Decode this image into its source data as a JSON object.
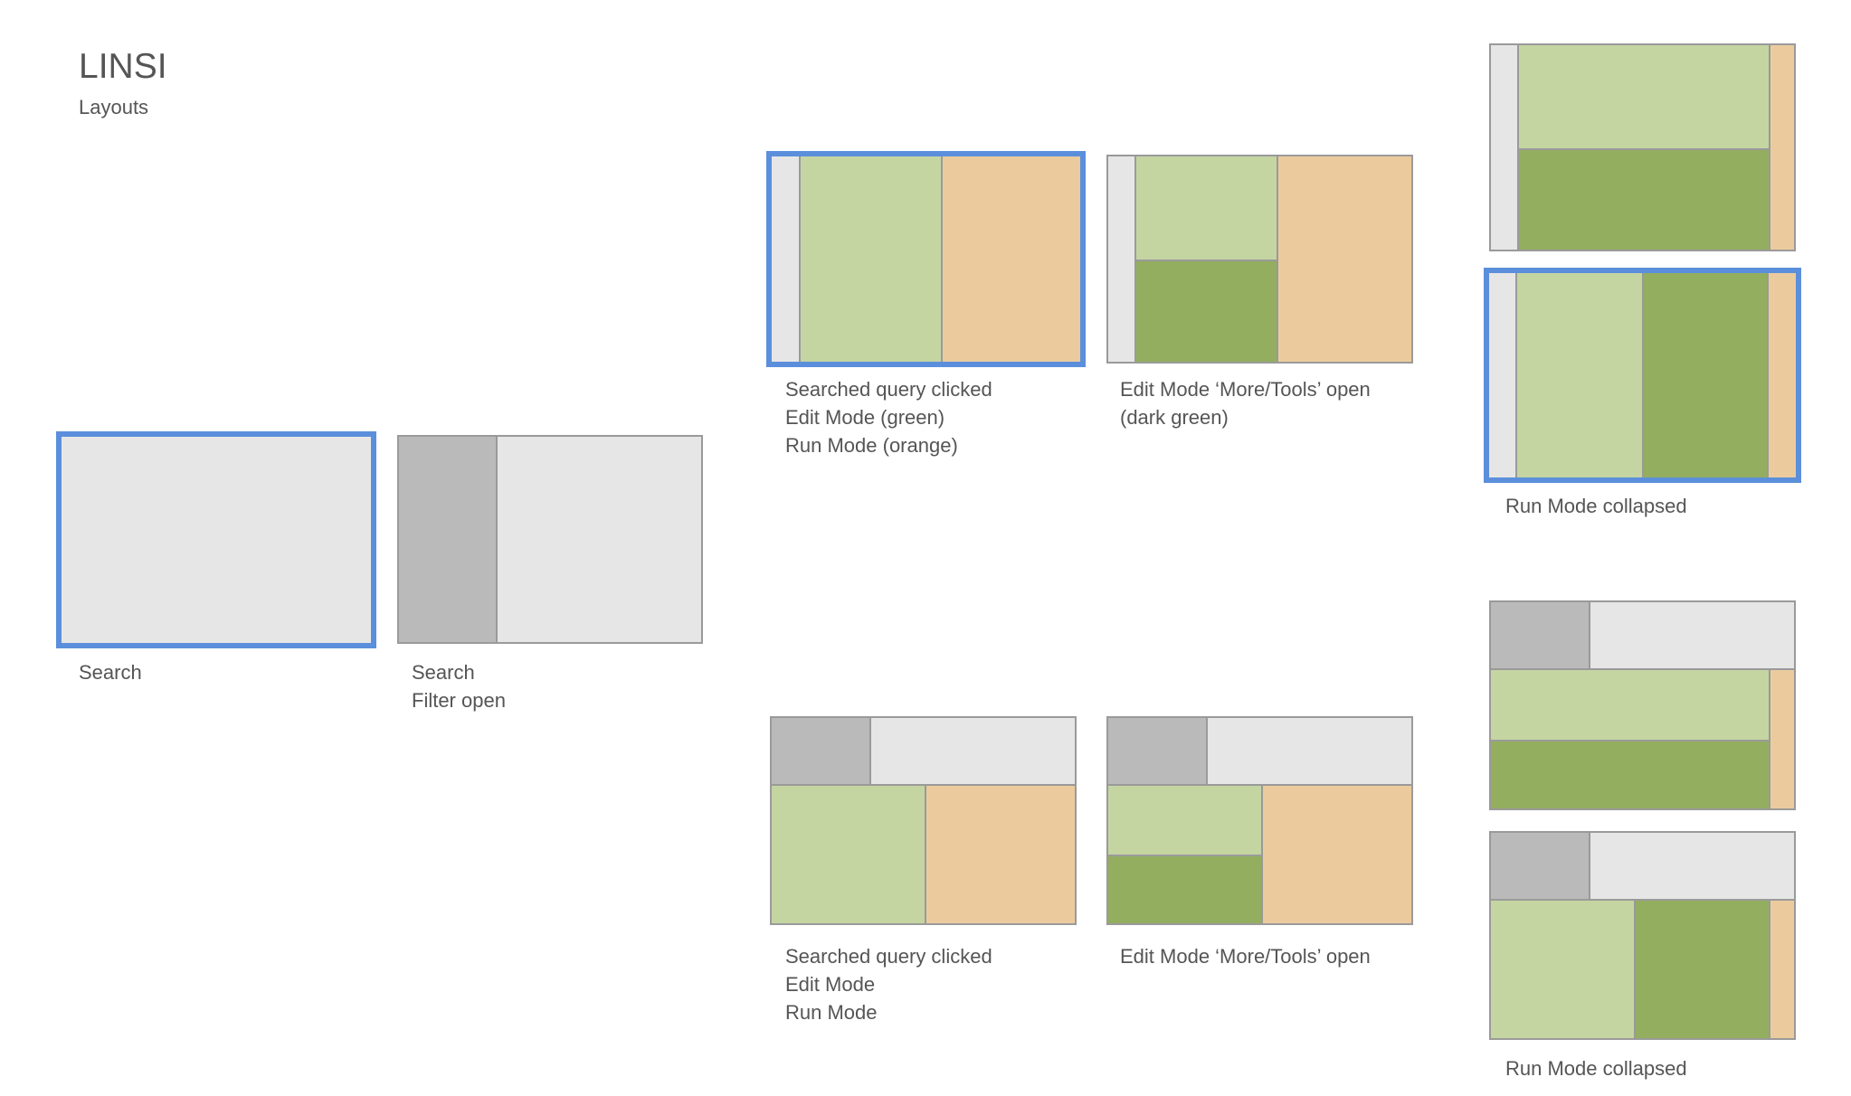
{
  "header": {
    "title": "LINSI",
    "subtitle": "Layouts"
  },
  "colors": {
    "selected_border": "#5b8fdb",
    "pane_light_grey": "#e6e6e6",
    "pane_mid_grey": "#bababa",
    "edit_mode_green": "#c4d5a2",
    "more_tools_dark_green": "#93ae5f",
    "run_mode_orange": "#ebcb9e"
  },
  "layouts": {
    "search": {
      "lines": [
        "Search"
      ]
    },
    "search_filter": {
      "lines": [
        "Search",
        "Filter open"
      ]
    },
    "query_clicked": {
      "lines": [
        "Searched query clicked",
        "Edit Mode (green)",
        "Run Mode (orange)"
      ]
    },
    "edit_more_tools": {
      "lines": [
        "Edit Mode ‘More/Tools’ open",
        "(dark green)"
      ]
    },
    "run_collapsed_top": {
      "lines": [
        "Run Mode collapsed"
      ]
    },
    "query_clicked_filter": {
      "lines": [
        "Searched query clicked",
        "Edit Mode",
        "Run Mode"
      ]
    },
    "edit_more_tools_filter": {
      "lines": [
        "Edit Mode ‘More/Tools’ open"
      ]
    },
    "run_collapsed_bottom": {
      "lines": [
        "Run Mode collapsed"
      ]
    }
  }
}
